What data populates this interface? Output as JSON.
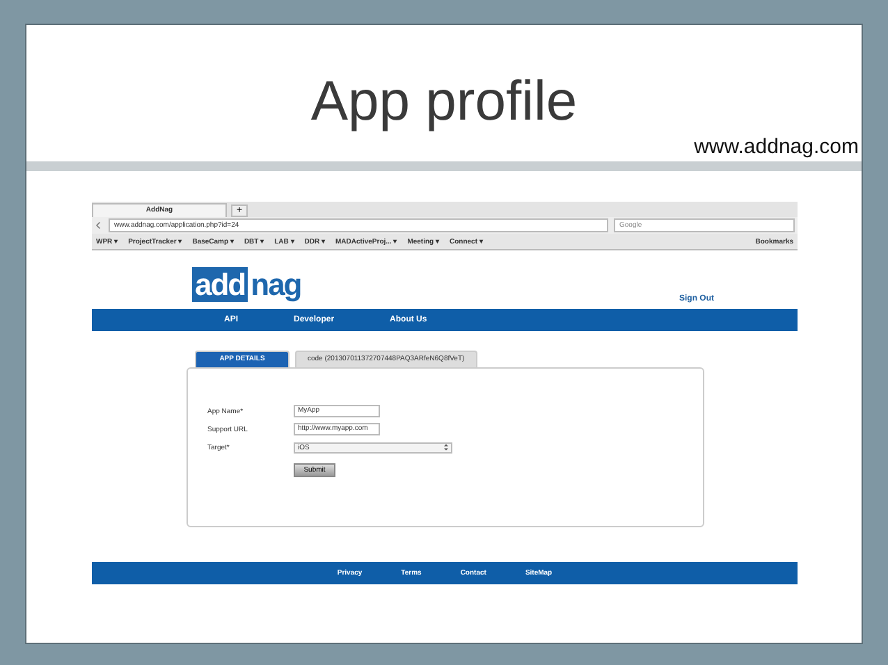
{
  "slide": {
    "title": "App profile",
    "url": "www.addnag.com"
  },
  "browser": {
    "tab_title": "AddNag",
    "new_tab": "+",
    "address": "www.addnag.com/application.php?id=24",
    "search_placeholder": "Google",
    "bookmarks": [
      "WPR ▾",
      "ProjectTracker ▾",
      "BaseCamp ▾",
      "DBT ▾",
      "LAB ▾",
      "DDR ▾",
      "MADActiveProj... ▾",
      "Meeting ▾",
      "Connect ▾"
    ],
    "bookmarks_menu": "Bookmarks"
  },
  "site": {
    "logo_left": "add",
    "logo_right": "nag",
    "sign_out": "Sign Out",
    "nav": [
      "API",
      "Developer",
      "About Us"
    ],
    "tabs": [
      {
        "label": "APP DETAILS",
        "selected": true
      },
      {
        "label": "code (201307011372707448PAQ3ARfeN6Q8fVeT)",
        "selected": false
      }
    ],
    "fields": [
      {
        "kind": "text",
        "label": "App Name*",
        "value": "MyApp"
      },
      {
        "kind": "text",
        "label": "Support URL",
        "value": "http://www.myapp.com"
      },
      {
        "kind": "select",
        "label": "Target*",
        "value": "iOS"
      }
    ],
    "submit": "Submit",
    "footer": [
      "Privacy",
      "Terms",
      "Contact",
      "SiteMap"
    ]
  }
}
